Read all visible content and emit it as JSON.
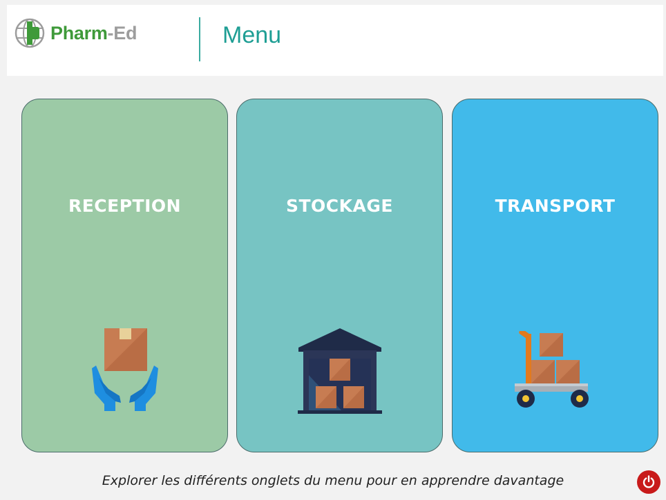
{
  "header": {
    "logo_part1": "Pharm",
    "logo_part2": "-Ed",
    "title": "Menu"
  },
  "cards": [
    {
      "label": "RECEPTION",
      "color": "#9ccaa6",
      "icon": "box-in-hands-icon"
    },
    {
      "label": "STOCKAGE",
      "color": "#77c4c3",
      "icon": "warehouse-icon"
    },
    {
      "label": "TRANSPORT",
      "color": "#41baea",
      "icon": "hand-truck-icon"
    }
  ],
  "footer": {
    "text": "Explorer les différents onglets du menu pour en apprendre davantage",
    "power_icon": "power-icon",
    "power_color": "#c81a1a"
  }
}
